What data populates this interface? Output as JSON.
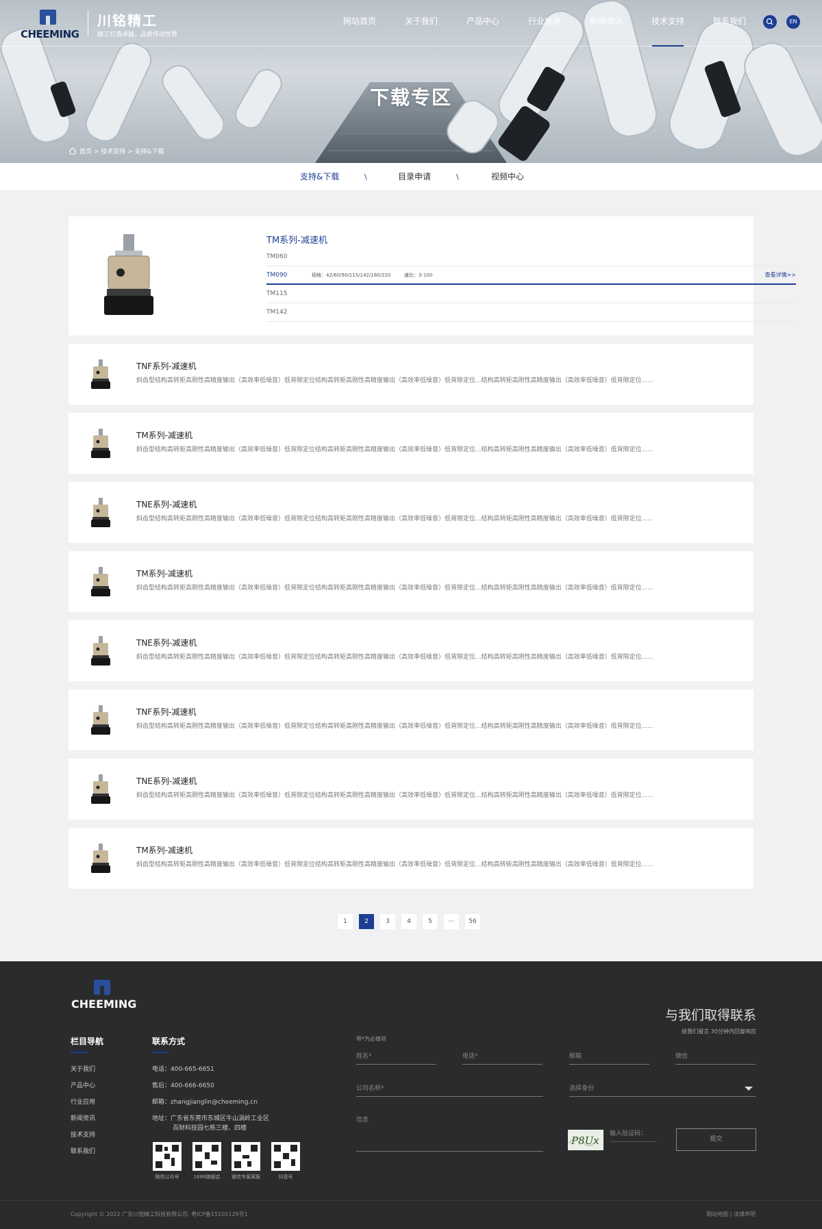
{
  "header": {
    "logo_text": "CHEEMING",
    "brand_name": "川铭精工",
    "slogan": "精工打造卓越，品质传动世界",
    "nav": [
      "网站首页",
      "关于我们",
      "产品中心",
      "行业应用",
      "新闻资讯",
      "技术支持",
      "联系我们"
    ],
    "lang_label": "EN"
  },
  "banner": {
    "title": "下载专区",
    "breadcrumb": "首页 > 技术支持 > 支持&下载"
  },
  "subnav": {
    "items": [
      "支持&下载",
      "目录申请",
      "视频中心"
    ],
    "separator": "\\"
  },
  "featured": {
    "title": "TM系列-减速机",
    "rows": [
      {
        "model": "TM060"
      },
      {
        "model": "TM090",
        "spec": "规格：42/60/90/115/142/180/220",
        "ratio": "速比：3-100",
        "more": "查看详情>>"
      },
      {
        "model": "TM115"
      },
      {
        "model": "TM142"
      }
    ]
  },
  "products": [
    {
      "name": "TNF系列-减速机",
      "desc": "斜齿型结构高转矩高刚性高精度输出（高效率低噪音）低背隙定位结构高转矩高刚性高精度输出（高效率低噪音）低背隙定位...结构高转矩高刚性高精度输出（高效率低噪音）低背隙定位......"
    },
    {
      "name": "TM系列-减速机",
      "desc": "斜齿型结构高转矩高刚性高精度输出（高效率低噪音）低背隙定位结构高转矩高刚性高精度输出（高效率低噪音）低背隙定位...结构高转矩高刚性高精度输出（高效率低噪音）低背隙定位......"
    },
    {
      "name": "TNE系列-减速机",
      "desc": "斜齿型结构高转矩高刚性高精度输出（高效率低噪音）低背隙定位结构高转矩高刚性高精度输出（高效率低噪音）低背隙定位...结构高转矩高刚性高精度输出（高效率低噪音）低背隙定位......"
    },
    {
      "name": "TM系列-减速机",
      "desc": "斜齿型结构高转矩高刚性高精度输出（高效率低噪音）低背隙定位结构高转矩高刚性高精度输出（高效率低噪音）低背隙定位...结构高转矩高刚性高精度输出（高效率低噪音）低背隙定位......"
    },
    {
      "name": "TNE系列-减速机",
      "desc": "斜齿型结构高转矩高刚性高精度输出（高效率低噪音）低背隙定位结构高转矩高刚性高精度输出（高效率低噪音）低背隙定位...结构高转矩高刚性高精度输出（高效率低噪音）低背隙定位......"
    },
    {
      "name": "TNF系列-减速机",
      "desc": "斜齿型结构高转矩高刚性高精度输出（高效率低噪音）低背隙定位结构高转矩高刚性高精度输出（高效率低噪音）低背隙定位...结构高转矩高刚性高精度输出（高效率低噪音）低背隙定位......"
    },
    {
      "name": "TNE系列-减速机",
      "desc": "斜齿型结构高转矩高刚性高精度输出（高效率低噪音）低背隙定位结构高转矩高刚性高精度输出（高效率低噪音）低背隙定位...结构高转矩高刚性高精度输出（高效率低噪音）低背隙定位......"
    },
    {
      "name": "TM系列-减速机",
      "desc": "斜齿型结构高转矩高刚性高精度输出（高效率低噪音）低背隙定位结构高转矩高刚性高精度输出（高效率低噪音）低背隙定位...结构高转矩高刚性高精度输出（高效率低噪音）低背隙定位......"
    }
  ],
  "pagination": {
    "pages": [
      "1",
      "2",
      "3",
      "4",
      "5",
      "···",
      "56"
    ],
    "current": "2"
  },
  "footer": {
    "logo_text": "CHEEMING",
    "nav_title": "栏目导航",
    "nav_links": [
      "关于我们",
      "产品中心",
      "行业应用",
      "新闻资讯",
      "技术支持",
      "联系我们"
    ],
    "contact_title": "联系方式",
    "contact": [
      "电话：400-665-6651",
      "售后：400-666-6650",
      "邮箱：zhangjianglin@cheeming.cn",
      "地址：广东省东莞市东城区牛山涡岭工业区",
      "百财科技园七栋三楼、四楼"
    ],
    "qr_labels": [
      "微信公众号",
      "1688旗舰店",
      "微信专属客服",
      "抖音号"
    ],
    "form_title": "与我们取得联系",
    "form_subtitle": "给我们留言 30分钟内回复响应",
    "form_hint": "带*为必填项",
    "fields": {
      "name": "姓名*",
      "phone": "电话*",
      "email": "邮箱",
      "wechat": "微信",
      "company": "公司名称*",
      "identity": "选择身份",
      "message": "信息",
      "captcha": "输入验证码："
    },
    "captcha_text": "P8Ux",
    "submit_label": "提交",
    "copyright": "Copyright © 2022 广东川铭精工科技有限公司. 粤ICP备15101129号1",
    "bottom_links": "网站地图 | 法律声明"
  }
}
